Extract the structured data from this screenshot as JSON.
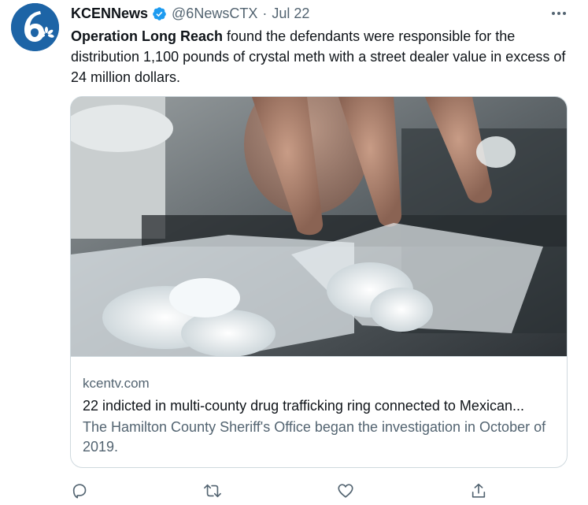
{
  "tweet": {
    "display_name": "KCENNews",
    "handle": "@6NewsCTX",
    "separator": "·",
    "date": "Jul 22",
    "text_bold": "Operation Long Reach",
    "text_rest": " found the defendants were responsible for the distribution 1,100 pounds of crystal meth with a street dealer value in excess of 24 million dollars."
  },
  "card": {
    "domain": "kcentv.com",
    "title": "22 indicted in multi-county drug trafficking ring connected to Mexican...",
    "description": "The Hamilton County Sheriff's Office began the investigation in October of 2019."
  },
  "icons": {
    "avatar": "kcen-6-logo",
    "verified": "verified-badge-icon",
    "more": "more-options-icon",
    "reply": "reply-icon",
    "retweet": "retweet-icon",
    "like": "like-icon",
    "share": "share-icon"
  },
  "colors": {
    "text": "#0f1419",
    "secondary": "#536471",
    "verified": "#1d9bf0",
    "border": "#cfd9de",
    "avatar_bg": "#1d64a6"
  }
}
